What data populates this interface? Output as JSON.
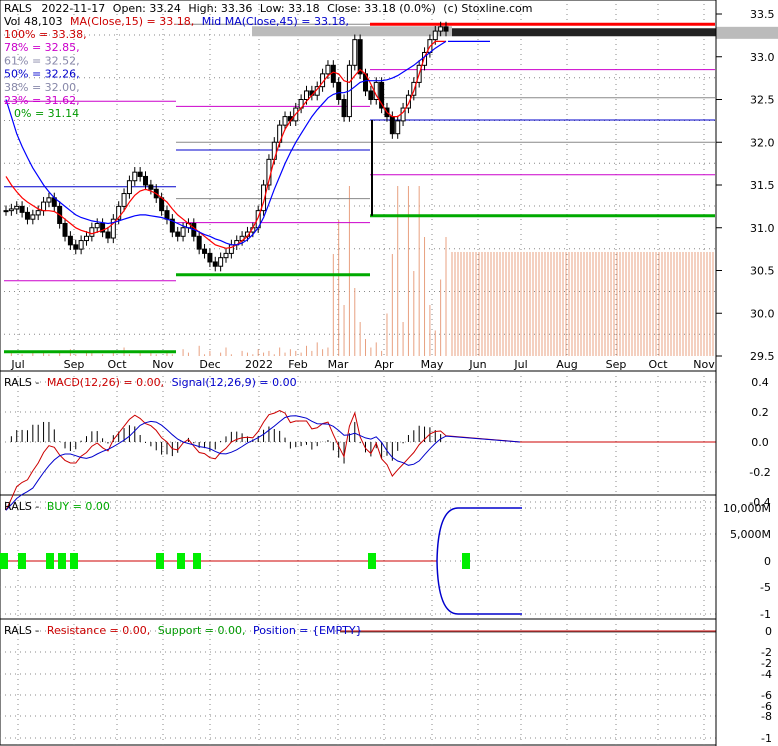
{
  "chart_data": [
    {
      "type": "candlestick",
      "header": {
        "symbol": "RALS",
        "date": "2022-11-17",
        "open_label": "Open: 33.24",
        "high_label": "High: 33.36",
        "low_label": "Low: 33.18",
        "close_label": "Close: 33.18 (0.0%)",
        "credit": "(c) Stoxline.com",
        "vol_label": "Vol 48,103",
        "ma_label": "MA(Close,15) = 33.18,",
        "midma_label": "Mid MA(Close,45) = 33.18,"
      },
      "fib_levels": [
        {
          "label": "100% = 33.38,",
          "value": 33.38,
          "color": "#cc0000"
        },
        {
          "label": "78% = 32.85,",
          "value": 32.85,
          "color": "#cc00cc"
        },
        {
          "label": "61% = 32.52,",
          "value": 32.52,
          "color": "#8888aa"
        },
        {
          "label": "50% = 32.26,",
          "value": 32.26,
          "color": "#0000cc"
        },
        {
          "label": "38% = 32.00,",
          "value": 32.0,
          "color": "#8888aa"
        },
        {
          "label": "23% = 31.62,",
          "value": 31.62,
          "color": "#cc00cc"
        },
        {
          "label": "0% = 31.14",
          "value": 31.14,
          "color": "#009900"
        }
      ],
      "months": [
        "Jul",
        "Sep",
        "Oct",
        "Nov",
        "Dec",
        "2022",
        "Feb",
        "Mar",
        "Apr",
        "May",
        "Jun",
        "Jul",
        "Aug",
        "Sep",
        "Oct",
        "Nov"
      ],
      "y_ticks": [
        "33.5",
        "33.0",
        "32.5",
        "32.0",
        "31.5",
        "31.0",
        "30.5",
        "30.0",
        "29.5"
      ],
      "ylim": [
        29.5,
        33.5
      ],
      "closes": [
        31.2,
        31.22,
        31.25,
        31.18,
        31.1,
        31.15,
        31.2,
        31.3,
        31.35,
        31.25,
        31.05,
        30.9,
        30.8,
        30.75,
        30.85,
        30.9,
        31.0,
        31.05,
        30.95,
        30.88,
        31.1,
        31.25,
        31.4,
        31.55,
        31.65,
        31.6,
        31.5,
        31.45,
        31.35,
        31.2,
        31.1,
        30.95,
        30.9,
        31.0,
        31.05,
        30.9,
        30.75,
        30.7,
        30.6,
        30.55,
        30.65,
        30.7,
        30.8,
        30.85,
        30.9,
        30.95,
        31.0,
        31.2,
        31.5,
        31.8,
        32.0,
        32.2,
        32.3,
        32.25,
        32.4,
        32.5,
        32.6,
        32.55,
        32.65,
        32.8,
        32.9,
        32.7,
        32.5,
        32.3,
        32.9,
        33.2,
        32.8,
        32.6,
        32.5,
        32.7,
        32.4,
        32.3,
        32.1,
        32.25,
        32.4,
        32.55,
        32.7,
        32.9,
        33.05,
        33.2,
        33.3,
        33.35,
        33.3
      ],
      "ma15": [
        31.6,
        31.5,
        31.42,
        31.35,
        31.3,
        31.26,
        31.22,
        31.2,
        31.2,
        31.19,
        31.15,
        31.1,
        31.05,
        31.0,
        30.97,
        30.95,
        30.93,
        30.95,
        30.97,
        31.0,
        31.05,
        31.12,
        31.2,
        31.3,
        31.38,
        31.43,
        31.45,
        31.43,
        31.4,
        31.35,
        31.3,
        31.22,
        31.15,
        31.1,
        31.05,
        31.0,
        30.95,
        30.9,
        30.85,
        30.8,
        30.78,
        30.76,
        30.77,
        30.8,
        30.85,
        30.9,
        31.0,
        31.12,
        31.3,
        31.55,
        31.8,
        32.0,
        32.15,
        32.25,
        32.33,
        32.4,
        32.48,
        32.55,
        32.62,
        32.7,
        32.78,
        32.82,
        32.8,
        32.72,
        32.7,
        32.78,
        32.85,
        32.8,
        32.68,
        32.55,
        32.45,
        32.35,
        32.3,
        32.3,
        32.35,
        32.45,
        32.6,
        32.8,
        33.0,
        33.12,
        33.18,
        33.18,
        33.18
      ],
      "midma": [
        32.5,
        32.3,
        32.1,
        31.95,
        31.82,
        31.7,
        31.6,
        31.5,
        31.42,
        31.35,
        31.3,
        31.25,
        31.2,
        31.15,
        31.12,
        31.1,
        31.08,
        31.07,
        31.06,
        31.05,
        31.06,
        31.08,
        31.1,
        31.12,
        31.14,
        31.15,
        31.15,
        31.14,
        31.13,
        31.12,
        31.1,
        31.08,
        31.05,
        31.02,
        31.0,
        30.98,
        30.95,
        30.92,
        30.9,
        30.87,
        30.85,
        30.82,
        30.8,
        30.8,
        30.82,
        30.86,
        30.92,
        31.0,
        31.12,
        31.28,
        31.45,
        31.6,
        31.75,
        31.88,
        32.0,
        32.1,
        32.2,
        32.3,
        32.38,
        32.45,
        32.52,
        32.56,
        32.58,
        32.58,
        32.6,
        32.65,
        32.7,
        32.72,
        32.72,
        32.72,
        32.72,
        32.73,
        32.75,
        32.78,
        32.82,
        32.86,
        32.9,
        32.95,
        33.0,
        33.05,
        33.1,
        33.14,
        33.18
      ],
      "volume": [
        0,
        2,
        0,
        1,
        0,
        3,
        0,
        2,
        1,
        0,
        2,
        0,
        4,
        1,
        0,
        2,
        3,
        0,
        1,
        0,
        2,
        0,
        5,
        1,
        0,
        2,
        0,
        3,
        1,
        0,
        2,
        1,
        0,
        4,
        2,
        0,
        6,
        1,
        3,
        0,
        2,
        5,
        1,
        0,
        3,
        2,
        1,
        4,
        2,
        3,
        1,
        5,
        2,
        4,
        3,
        2,
        6,
        3,
        8,
        4,
        5,
        60,
        80,
        30,
        100,
        40,
        20,
        10,
        5,
        8,
        3,
        25,
        60,
        100,
        20,
        100,
        50,
        100,
        70,
        30,
        15,
        45,
        70
      ]
    },
    {
      "type": "line",
      "title": "RALS - MACD(12,26) = 0.00, Signal(12,26,9) = 0.00",
      "parts": {
        "symbol": "RALS -",
        "macd": "MACD(12,26) = 0.00,",
        "signal": "Signal(12,26,9) = 0.00"
      },
      "y_ticks": [
        "0.4",
        "0.2",
        "0.0",
        "-0.2",
        "-0.4"
      ],
      "ylim": [
        -0.5,
        0.5
      ]
    },
    {
      "type": "line",
      "title": "RALS - BUY = 0.00",
      "parts": {
        "symbol": "RALS -",
        "buy": "BUY = 0.00"
      },
      "y_ticks": [
        "10,000M",
        "5,000M",
        "0",
        "-5",
        "-1"
      ]
    },
    {
      "type": "line",
      "title": "RALS - Resistance = 0.00, Support = 0.00, Position = {EMPTY}",
      "parts": {
        "symbol": "RALS -",
        "resistance": "Resistance = 0.00,",
        "support": "Support = 0.00,",
        "position": "Position = {EMPTY}"
      },
      "y_ticks": [
        "0",
        "-2",
        "-2",
        "-4",
        "-6",
        "-6",
        "-8",
        "-1"
      ]
    }
  ]
}
